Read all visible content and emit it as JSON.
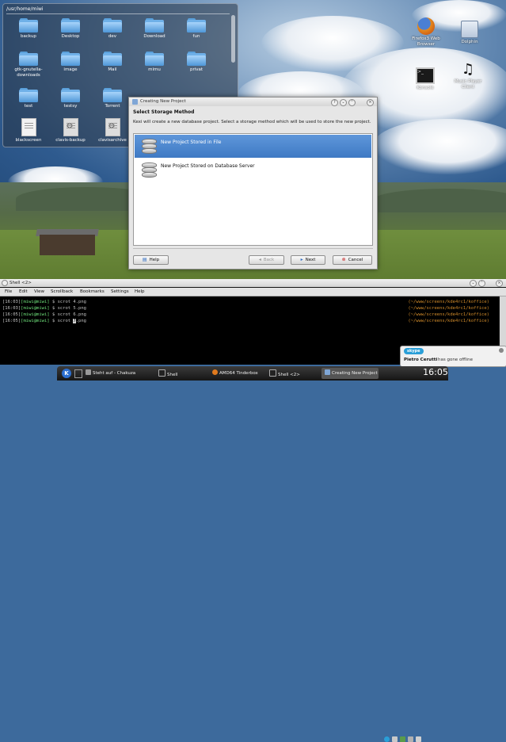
{
  "folder_view": {
    "path": "/usr/home/miwi",
    "items": [
      {
        "label": "backup",
        "type": "folder"
      },
      {
        "label": "Desktop",
        "type": "folder"
      },
      {
        "label": "dev",
        "type": "folder"
      },
      {
        "label": "Download",
        "type": "folder"
      },
      {
        "label": "fun",
        "type": "folder"
      },
      {
        "label": "gtk-gnutella-downloads",
        "type": "folder"
      },
      {
        "label": "image",
        "type": "folder"
      },
      {
        "label": "Mail",
        "type": "folder"
      },
      {
        "label": "mimu",
        "type": "folder"
      },
      {
        "label": "privat",
        "type": "folder"
      },
      {
        "label": "test",
        "type": "folder"
      },
      {
        "label": "testsy",
        "type": "folder"
      },
      {
        "label": "Torrent",
        "type": "folder"
      },
      {
        "label": "blackscreen",
        "type": "file"
      },
      {
        "label": "clavis-backup",
        "type": "archive"
      },
      {
        "label": "clavisarchive",
        "type": "archive"
      }
    ]
  },
  "desktop_icons": [
    {
      "label": "Firefox3 Web Browser",
      "icon": "firefox-icon"
    },
    {
      "label": "Dolphin",
      "icon": "dolphin-icon"
    },
    {
      "label": "Konsole",
      "icon": "konsole-icon"
    },
    {
      "label": "Music Player Client",
      "icon": "music-icon"
    }
  ],
  "dialog": {
    "title": "Creating New Project",
    "heading": "Select Storage Method",
    "description": "Kexi will create a new database project. Select a storage method which will be used to store the new project.",
    "options": [
      {
        "label": "New Project Stored in File",
        "selected": true
      },
      {
        "label": "New Project Stored on Database Server",
        "selected": false
      }
    ],
    "buttons": {
      "help": "Help",
      "back": "Back",
      "next": "Next",
      "cancel": "Cancel"
    }
  },
  "konsole": {
    "title": "Shell <2>",
    "menu": [
      "File",
      "Edit",
      "View",
      "Scrollback",
      "Bookmarks",
      "Settings",
      "Help"
    ],
    "lines": [
      {
        "time": "[16:03]",
        "user": "[miwi@miwi]",
        "prompt": "$",
        "cmd": "scrot 4.png",
        "path": "(~/www/screens/kde4rc1/koffice)"
      },
      {
        "time": "[16:03]",
        "user": "[miwi@miwi]",
        "prompt": "$",
        "cmd": "scrot 5.png",
        "path": "(~/www/screens/kde4rc1/koffice)"
      },
      {
        "time": "[16:05]",
        "user": "[miwi@miwi]",
        "prompt": "$",
        "cmd": "scrot 6.png",
        "path": "(~/www/screens/kde4rc1/koffice)"
      },
      {
        "time": "[16:05]",
        "user": "[miwi@miwi]",
        "prompt": "$",
        "cmd": "scrot 7.png",
        "path": "(~/www/screens/kde4rc1/koffice)"
      }
    ]
  },
  "notification": {
    "app": "skype",
    "name": "Pietro Cerutti",
    "message": "has gone offline"
  },
  "taskbar": {
    "tasks": [
      {
        "label": "Steht auf - Chakuza"
      },
      {
        "label": "Shell"
      },
      {
        "label": "AMD64 Tinderbox"
      },
      {
        "label": "Shell <2>"
      },
      {
        "label": "Creating New Project"
      }
    ],
    "clock": "16:05"
  }
}
